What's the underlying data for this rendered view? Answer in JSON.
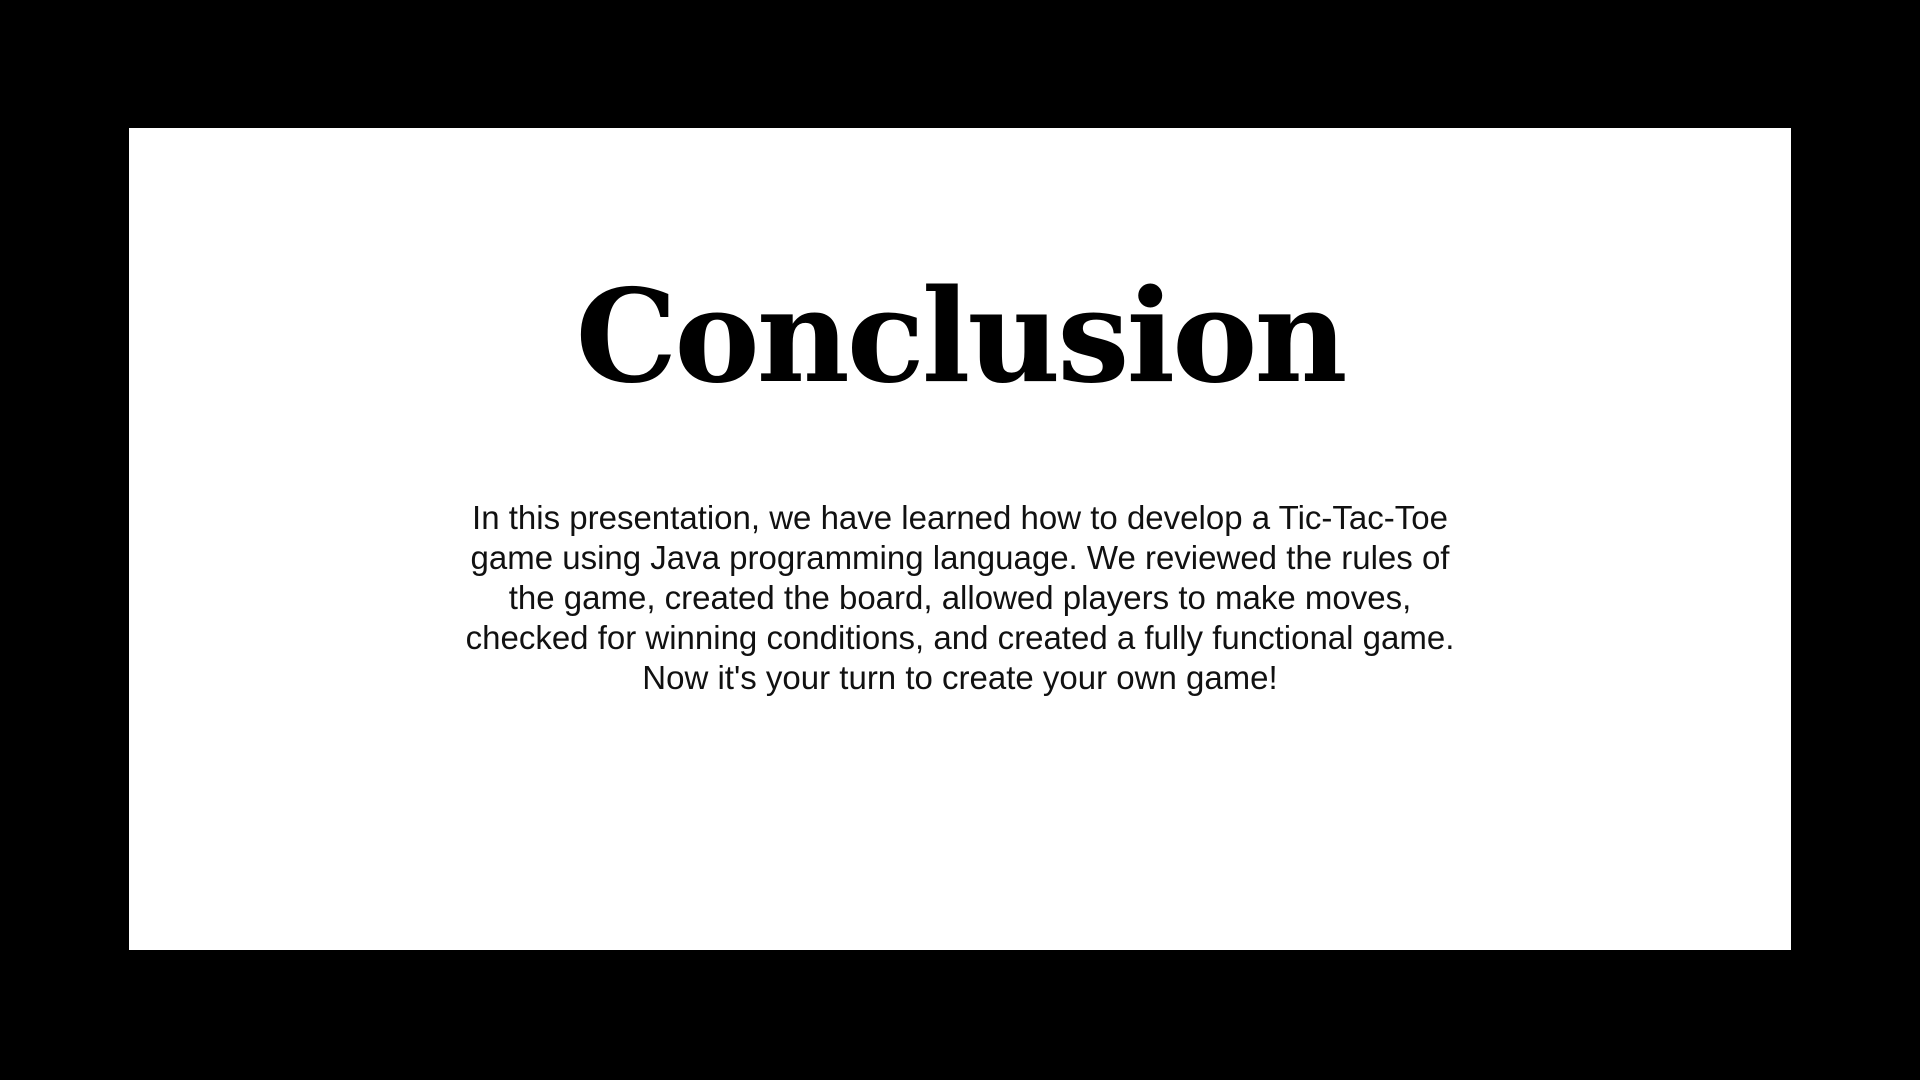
{
  "slide": {
    "title": "Conclusion",
    "body": "In this presentation, we have learned how to develop a Tic-Tac-Toe game using Java programming language. We reviewed the rules of the game, created the board, allowed players to make moves, checked for winning conditions, and created a fully functional game. Now it's your turn to create your own game!"
  },
  "colors": {
    "frame": "#000000",
    "card": "#ffffff",
    "text": "#000000"
  }
}
